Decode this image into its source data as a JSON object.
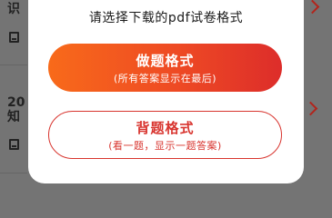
{
  "background_list": {
    "row1_title": "识",
    "row2_title_line1": "20",
    "row2_title_line2": "知"
  },
  "modal": {
    "prompt": "请选择下载的pdf试卷格式",
    "primary_button": {
      "title": "做题格式",
      "subtitle": "(所有答案显示在最后)"
    },
    "secondary_button": {
      "title": "背题格式",
      "subtitle": "(看一题，显示一题答案)"
    }
  },
  "colors": {
    "accent": "#d8342e",
    "gradient_start": "#f86a1a",
    "gradient_end": "#dd2d2a"
  }
}
